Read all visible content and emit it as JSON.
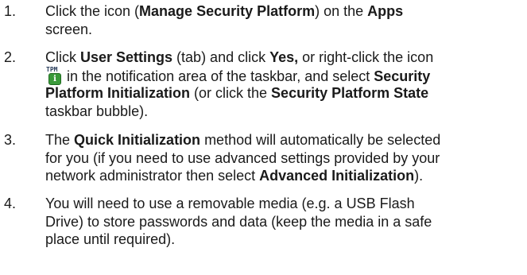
{
  "steps": [
    {
      "number": "1.",
      "lines": [
        {
          "t1": "Click the icon (",
          "b1": "Manage Security Platform",
          "t2": ") on the ",
          "b2": "Apps"
        },
        {
          "t1": "screen."
        }
      ]
    },
    {
      "number": "2.",
      "lines": [
        {
          "t1": "Click ",
          "b1": "User Settings",
          "t2": " (tab) and click ",
          "b2": "Yes,",
          "t3": " or right-click the icon"
        },
        {
          "t1": " in the notification area of the taskbar, and select ",
          "b1": "Security"
        },
        {
          "b1": "Platform Initialization",
          "t1": " (or click the ",
          "b2": "Security Platform State"
        },
        {
          "t1": "taskbar bubble)."
        }
      ]
    },
    {
      "number": "3.",
      "lines": [
        {
          "t1": "The ",
          "b1": "Quick Initialization",
          "t2": " method will automatically be selected"
        },
        {
          "t1": "for you (if you need to use advanced settings provided by your"
        },
        {
          "t1": "network administrator then select ",
          "b1": "Advanced Initialization",
          "t2": ")."
        }
      ]
    },
    {
      "number": "4.",
      "lines": [
        {
          "t1": "You will need to use a removable media (e.g. a USB Flash"
        },
        {
          "t1": "Drive) to store passwords and data (keep the media in a safe"
        },
        {
          "t1": "place until required)."
        }
      ]
    }
  ],
  "tpm_icon": {
    "name": "tpm-notification-icon",
    "label_top": "TPM",
    "label_badge": "i",
    "badge_color": "#3a9a3a"
  }
}
